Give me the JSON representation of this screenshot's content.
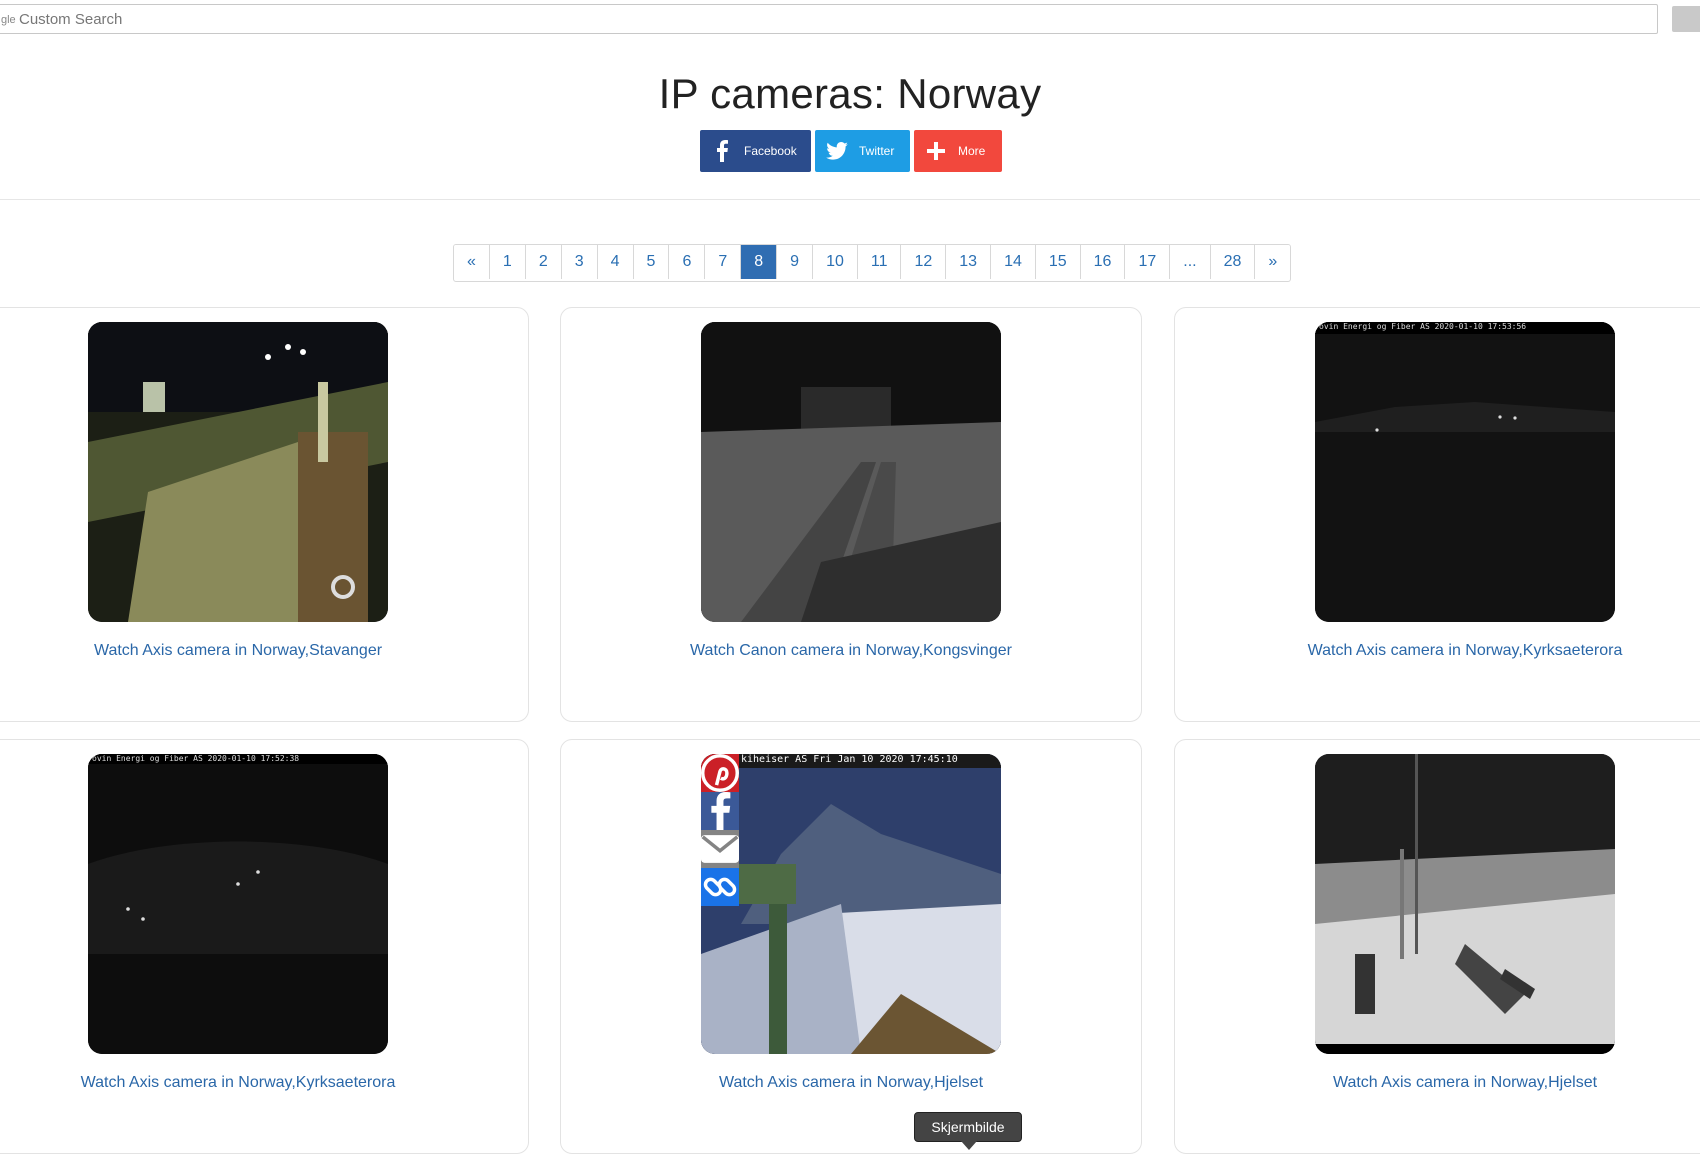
{
  "search": {
    "brand": "gle",
    "placeholder": "Custom Search"
  },
  "page": {
    "title": "IP cameras: Norway"
  },
  "share": {
    "facebook": "Facebook",
    "twitter": "Twitter",
    "more": "More"
  },
  "pagination": {
    "items": [
      "«",
      "1",
      "2",
      "3",
      "4",
      "5",
      "6",
      "7",
      "8",
      "9",
      "10",
      "11",
      "12",
      "13",
      "14",
      "15",
      "16",
      "17",
      "...",
      "28",
      "»"
    ],
    "active": "8"
  },
  "cameras": [
    {
      "link": "Watch Axis camera in Norway,Stavanger",
      "overlay": ""
    },
    {
      "link": "Watch Canon camera in Norway,Kongsvinger",
      "overlay": ""
    },
    {
      "link": "Watch Axis camera in Norway,Kyrksaeterora",
      "overlay": "ovin Energi og Fiber AS 2020-01-10 17:53:56"
    },
    {
      "link": "Watch Axis camera in Norway,Kyrksaeterora",
      "overlay": "ovin Energi og Fiber AS 2020-01-10 17:52:38"
    },
    {
      "link": "Watch Axis camera in Norway,Hjelset",
      "overlay": "kiheiser AS Fri Jan 10 2020 17:45:10"
    },
    {
      "link": "Watch Axis camera in Norway,Hjelset",
      "overlay": ""
    }
  ],
  "tooltip": "Skjermbilde",
  "colors": {
    "link": "#2a67a8",
    "active_page": "#2f6db2",
    "facebook": "#2b4c8c",
    "twitter": "#1e9de4",
    "more": "#f2483d"
  }
}
